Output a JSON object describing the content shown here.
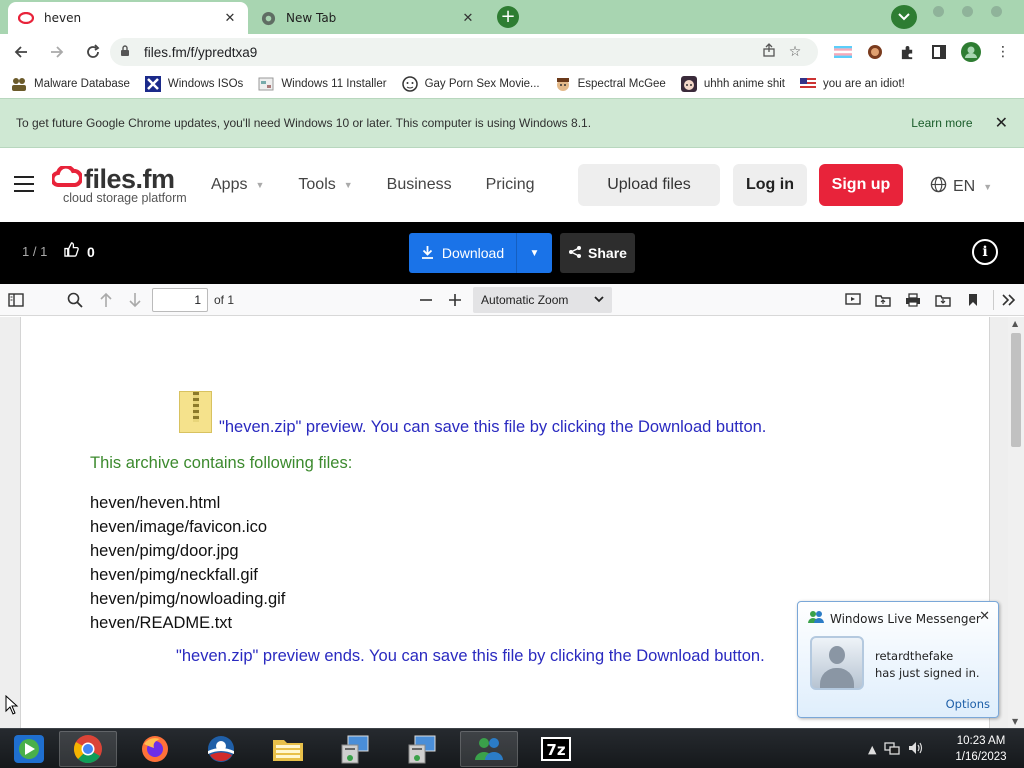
{
  "browser": {
    "tabs": [
      {
        "label": "heven",
        "icon": "filesfm-favicon-icon",
        "active": true
      },
      {
        "label": "New Tab",
        "icon": "chrome-favicon-icon",
        "active": false
      }
    ],
    "url": "files.fm/f/ypredtxa9",
    "accent_color": "#2e7d32",
    "frame_color": "#a8d5b1"
  },
  "bookmarks": [
    {
      "label": "Malware Database",
      "icon": "people-icon"
    },
    {
      "label": "Windows ISOs",
      "icon": "x-logo-icon"
    },
    {
      "label": "Windows 11 Installer",
      "icon": "page-icon"
    },
    {
      "label": "Gay Porn Sex Movie...",
      "icon": "face-icon"
    },
    {
      "label": "Espectral McGee",
      "icon": "face-icon"
    },
    {
      "label": "uhhh anime shit",
      "icon": "anime-icon"
    },
    {
      "label": "you are an idiot!",
      "icon": "flag-icon"
    }
  ],
  "infobar": {
    "message": "To get future Google Chrome updates, you'll need Windows 10 or later. This computer is using Windows 8.1.",
    "link": "Learn more"
  },
  "site": {
    "brand": "files.fm",
    "tagline": "cloud storage platform",
    "menu": [
      "Apps",
      "Tools",
      "Business",
      "Pricing"
    ],
    "upload": "Upload files",
    "login": "Log in",
    "signup": "Sign up",
    "language": "EN",
    "brand_color": "#e8233a"
  },
  "filebar": {
    "page_count": "1 / 1",
    "likes": "0",
    "download": "Download",
    "share": "Share"
  },
  "pdf": {
    "page": "1",
    "of": "of 1",
    "zoom": "Automatic Zoom"
  },
  "document": {
    "preview_top": "\"heven.zip\" preview. You can save this file by clicking the Download button.",
    "contains": "This archive contains following files:",
    "files": [
      "heven/heven.html",
      "heven/image/favicon.ico",
      "heven/pimg/door.jpg",
      "heven/pimg/neckfall.gif",
      "heven/pimg/nowloading.gif",
      "heven/README.txt"
    ],
    "preview_bottom": "\"heven.zip\" preview ends. You can save this file by clicking the Download button."
  },
  "messenger": {
    "title": "Windows Live Messenger",
    "user": "retardthefake",
    "status": "has just signed in.",
    "options": "Options"
  },
  "taskbar": {
    "apps": [
      "windows-media-center-icon",
      "chrome-icon",
      "firefox-icon",
      "obama-icon",
      "file-explorer-icon",
      "network-computer-icon",
      "network-computer-icon",
      "windows-live-messenger-icon",
      "seven-zip-icon"
    ],
    "seven_zip_label": "7z",
    "time": "10:23 AM",
    "date": "1/16/2023"
  }
}
